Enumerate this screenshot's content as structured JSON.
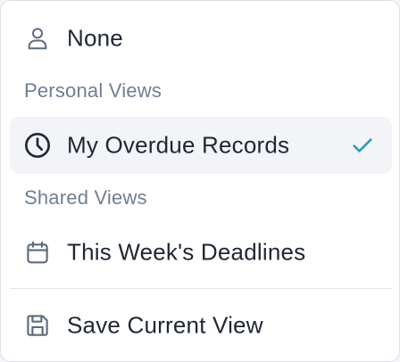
{
  "menu": {
    "none": {
      "label": "None",
      "icon": "user-icon"
    },
    "personal_header": "Personal Views",
    "personal_items": [
      {
        "label": "My Overdue Records",
        "icon": "clock-icon",
        "selected": true,
        "check_icon": "checkmark-icon"
      }
    ],
    "shared_header": "Shared Views",
    "shared_items": [
      {
        "label": "This Week's Deadlines",
        "icon": "calendar-icon"
      }
    ],
    "save": {
      "label": "Save Current View",
      "icon": "save-icon"
    }
  },
  "colors": {
    "text": "#1f2733",
    "section_header": "#6e7f93",
    "icon": "#5b6b80",
    "selected_bg": "#f2f4f7",
    "check": "#2b9bb8",
    "divider": "#e2e5ea"
  }
}
